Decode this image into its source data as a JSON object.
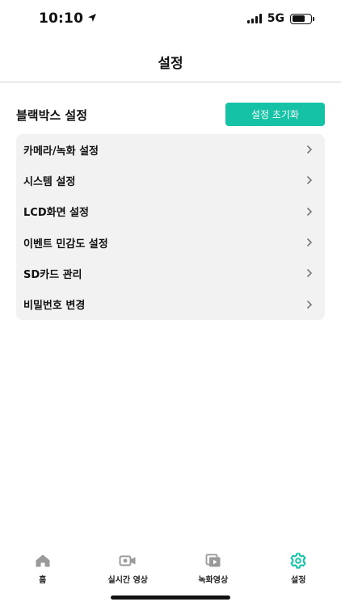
{
  "status_bar": {
    "time": "10:10",
    "network": "5G"
  },
  "header": {
    "title": "설정"
  },
  "section": {
    "title": "블랙박스 설정",
    "reset_label": "설정 초기화"
  },
  "menu": {
    "items": [
      {
        "label": "카메라/녹화 설정"
      },
      {
        "label": "시스템 설정"
      },
      {
        "label": "LCD화면 설정"
      },
      {
        "label": "이벤트 민감도 설정"
      },
      {
        "label": "SD카드 관리"
      },
      {
        "label": "비밀번호 변경"
      }
    ]
  },
  "tab_bar": {
    "tabs": [
      {
        "label": "홈",
        "icon": "home-icon"
      },
      {
        "label": "실시간 영상",
        "icon": "live-video-icon"
      },
      {
        "label": "녹화영상",
        "icon": "recorded-video-icon"
      },
      {
        "label": "설정",
        "icon": "gear-icon",
        "active": true
      }
    ]
  },
  "colors": {
    "accent": "#15c2a6",
    "inactive_icon": "#9a9a9a",
    "card_bg": "#f2f2f2"
  }
}
